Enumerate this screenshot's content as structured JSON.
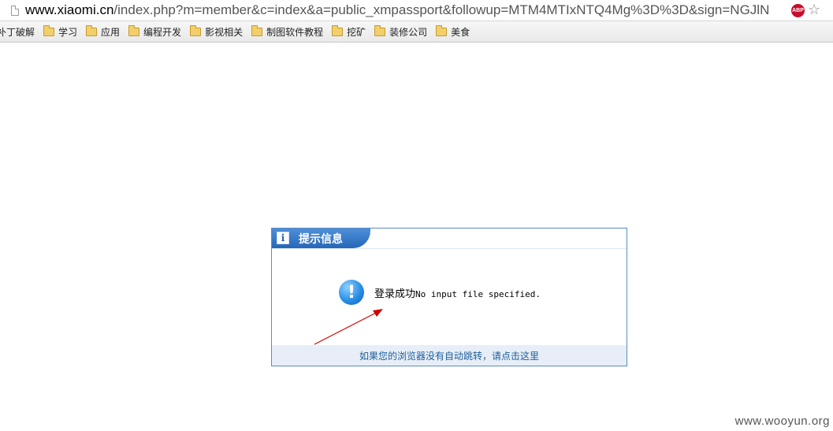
{
  "browser": {
    "url_host": "www.xiaomi.cn",
    "url_rest": "/index.php?m=member&c=index&a=public_xmpassport&followup=MTM4MTIxNTQ4Mg%3D%3D&sign=NGJlN",
    "abp_label": "ABP",
    "bookmarks": [
      "补丁破解",
      "学习",
      "应用",
      "编程开发",
      "影视相关",
      "制图软件教程",
      "挖矿",
      "装修公司",
      "美食"
    ]
  },
  "dialog": {
    "title": "提示信息",
    "info_glyph": "i",
    "alert_glyph": "!",
    "message_cn": "登录成功",
    "message_en": "No input file specified.",
    "redirect_text": "如果您的浏览器没有自动跳转，请点击这里"
  },
  "watermark": "www.wooyun.org",
  "colors": {
    "header_blue": "#2567b8",
    "border_blue": "#5b8cc4",
    "link_blue": "#1d5d9b",
    "arrow_red": "#d00000"
  }
}
